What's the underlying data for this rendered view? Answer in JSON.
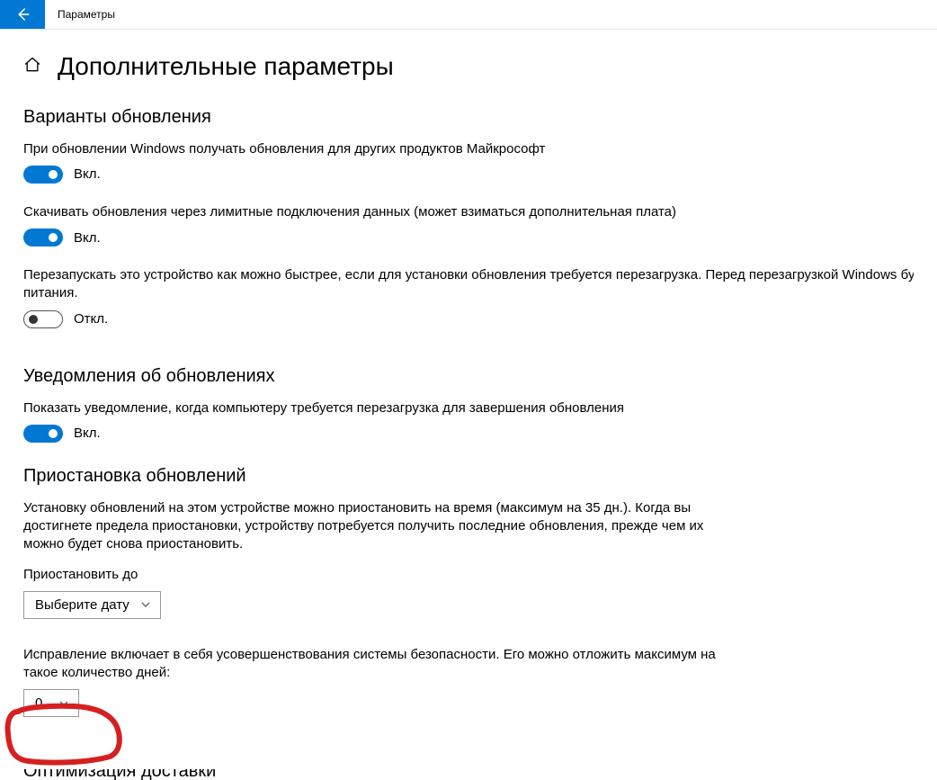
{
  "window": {
    "title": "Параметры"
  },
  "page": {
    "title": "Дополнительные параметры"
  },
  "sections": {
    "updateOptions": {
      "heading": "Варианты обновления",
      "opt1": {
        "text": "При обновлении Windows получать обновления для других продуктов Майкрософт",
        "state": "Вкл."
      },
      "opt2": {
        "text": "Скачивать обновления через лимитные подключения данных (может взиматься дополнительная плата)",
        "state": "Вкл."
      },
      "opt3": {
        "text": "Перезапускать это устройство как можно быстрее, если для установки обновления требуется перезагрузка. Перед перезагрузкой Windows будет включен и подключен к источнику питания.",
        "state": "Откл."
      }
    },
    "notifications": {
      "heading": "Уведомления об обновлениях",
      "opt1": {
        "text": "Показать уведомление, когда компьютеру требуется перезагрузка для завершения обновления",
        "state": "Вкл."
      }
    },
    "pause": {
      "heading": "Приостановка обновлений",
      "desc": "Установку обновлений на этом устройстве можно приостановить на время (максимум на 35 дн.). Когда вы достигнете предела приостановки, устройству потребуется получить последние обновления, прежде чем их можно будет снова приостановить.",
      "dateLabel": "Приостановить до",
      "datePlaceholder": "Выберите дату",
      "deferText": "Исправление включает в себя усовершенствования системы безопасности. Его можно отложить максимум на такое количество дней:",
      "deferValue": "0"
    },
    "delivery": {
      "heading": "Оптимизация доставки"
    }
  }
}
